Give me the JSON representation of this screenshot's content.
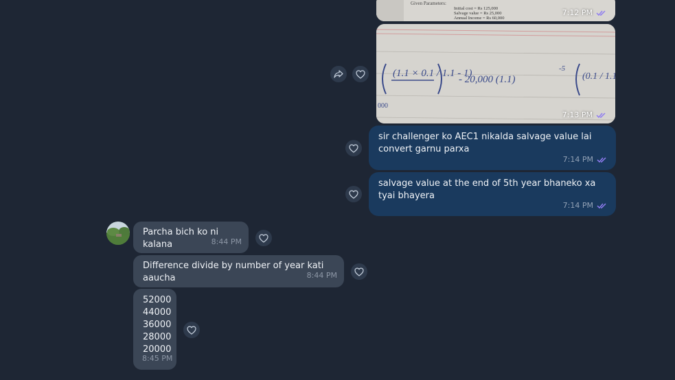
{
  "chat": {
    "messages": [
      {
        "direction": "outgoing",
        "type": "image",
        "time": "7:12 PM",
        "image_text": [
          "Given Parameters:",
          "Initial cost = Rs 125,000",
          "Salvage value = Rs 25,000",
          "Annual Income = Rs 60,000"
        ]
      },
      {
        "direction": "outgoing",
        "type": "image",
        "time": "7:13 PM",
        "image_text": [
          "(1.1 × 0.1 / 1.1 - 1)",
          "- 20,000 (1.1)",
          "-5",
          "(0.1 / 1.1-",
          "000"
        ]
      },
      {
        "direction": "outgoing",
        "type": "text",
        "time": "7:14 PM",
        "text": "sir challenger ko AEC1 nikalda salvage value lai convert garnu parxa"
      },
      {
        "direction": "outgoing",
        "type": "text",
        "time": "7:14 PM",
        "text": "salvage value at the end of 5th year bhaneko xa tyai bhayera"
      },
      {
        "direction": "incoming",
        "type": "text",
        "time": "8:44 PM",
        "text": "Parcha bich ko ni kalana"
      },
      {
        "direction": "incoming",
        "type": "text",
        "time": "8:44 PM",
        "text": "Difference divide by number of year kati aaucha"
      },
      {
        "direction": "incoming",
        "type": "text",
        "time": "8:45 PM",
        "lines": [
          "52000",
          "44000",
          "36000",
          "28000",
          "20000"
        ]
      }
    ]
  },
  "icons": {
    "read_receipt": "double-check-icon",
    "react": "heart-icon",
    "forward": "share-icon"
  },
  "colors": {
    "background": "#1e2634",
    "outgoing_bubble": "#1a3a5e",
    "incoming_bubble": "#3b4656",
    "read_check": "#8f7cf0"
  }
}
